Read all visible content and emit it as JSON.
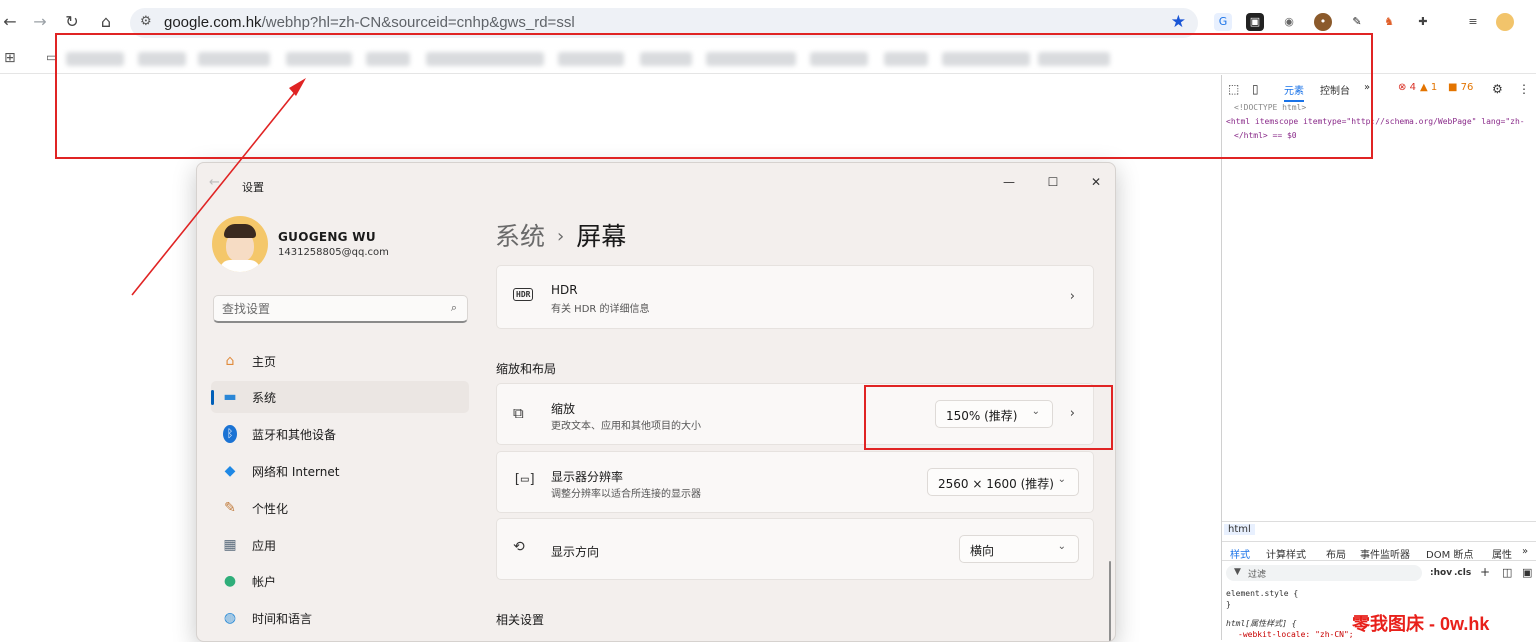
{
  "browser": {
    "url_host": "google.com.hk",
    "url_path": "/webhp?hl=zh-CN&sourceid=cnhp&gws_rd=ssl",
    "nav": {
      "back": "←",
      "forward": "→",
      "reload": "↻",
      "home": "⌂"
    }
  },
  "devtools": {
    "tabs": {
      "elements": "元素",
      "console": "控制台",
      "more": "»"
    },
    "counts": {
      "errors": "4",
      "warnings": "1",
      "issues": "76"
    },
    "dom_lines": [
      "<!DOCTYPE html>",
      "<html itemscope itemtype=\"http://schema.org/WebPage\" lang=\"zh-",
      "</html> == $0"
    ],
    "crumb": "html",
    "lower_tabs": [
      "样式",
      "计算样式",
      "布局",
      "事件监听器",
      "DOM 断点",
      "属性",
      "»"
    ],
    "filter_placeholder": "过滤",
    "filter_buttons": {
      "hov": ":hov",
      "cls": ".cls"
    },
    "style_lines": [
      "element.style {",
      "}",
      "html[属性样式] {",
      "-webkit-locale: \"zh-CN\";"
    ]
  },
  "settings": {
    "title": "设置",
    "user": {
      "name": "GUOGENG WU",
      "email": "1431258805@qq.com"
    },
    "search_placeholder": "查找设置",
    "nav": [
      {
        "label": "主页",
        "icon": "home-icon",
        "glyph": "⌂",
        "color": "#e08b3c"
      },
      {
        "label": "系统",
        "icon": "monitor-icon",
        "glyph": "▬",
        "color": "#2a86d6"
      },
      {
        "label": "蓝牙和其他设备",
        "icon": "bluetooth-icon",
        "glyph": "ᛒ",
        "color": "#1b73d4"
      },
      {
        "label": "网络和 Internet",
        "icon": "wifi-icon",
        "glyph": "◆",
        "color": "#1e88e5"
      },
      {
        "label": "个性化",
        "icon": "brush-icon",
        "glyph": "✎",
        "color": "#c07a3a"
      },
      {
        "label": "应用",
        "icon": "apps-icon",
        "glyph": "▦",
        "color": "#5a6b7c"
      },
      {
        "label": "帐户",
        "icon": "account-icon",
        "glyph": "●",
        "color": "#2fae7a"
      },
      {
        "label": "时间和语言",
        "icon": "globe-clock-icon",
        "glyph": "◍",
        "color": "#2a8bd6"
      }
    ],
    "breadcrumb": {
      "parent": "系统",
      "separator": "›",
      "current": "屏幕"
    },
    "hdr": {
      "title": "HDR",
      "subtitle": "有关 HDR 的详细信息",
      "icon_text": "HDR"
    },
    "section_scale": "缩放和布局",
    "scale": {
      "title": "缩放",
      "subtitle": "更改文本、应用和其他项目的大小",
      "value": "150% (推荐)"
    },
    "resolution": {
      "title": "显示器分辨率",
      "subtitle": "调整分辨率以适合所连接的显示器",
      "value": "2560 × 1600 (推荐)"
    },
    "orientation": {
      "title": "显示方向",
      "value": "横向"
    },
    "section_related": "相关设置",
    "window_controls": {
      "minimize": "—",
      "maximize": "☐",
      "close": "✕"
    }
  },
  "watermark": "零我图床 - 0w.hk",
  "colors": {
    "accent": "#005fb8",
    "annotation_red": "#e02424",
    "bookmark_star": "#1a56d6"
  }
}
